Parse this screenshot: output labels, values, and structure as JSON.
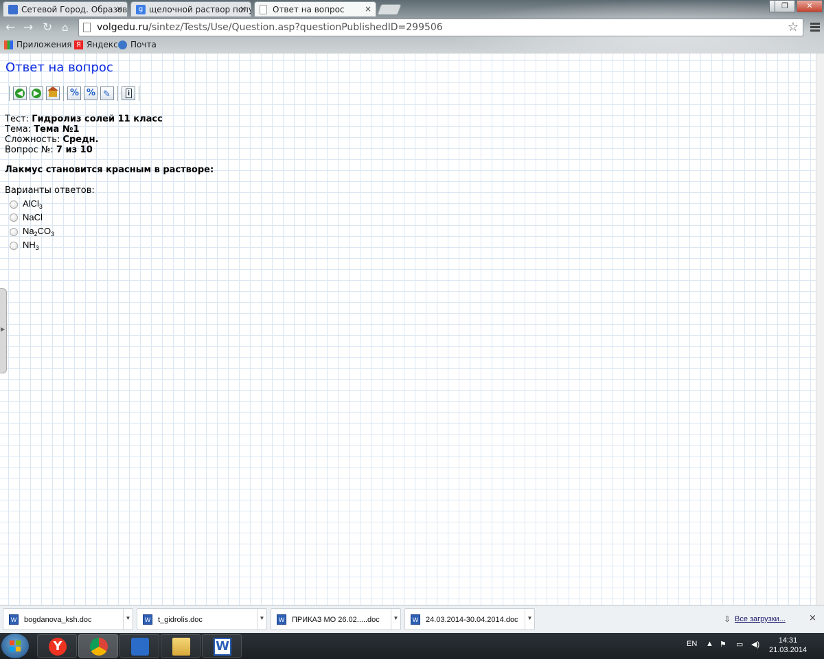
{
  "browser": {
    "tabs": [
      {
        "title": "Сетевой Город. Образов",
        "icon": "network-city-icon",
        "active": false
      },
      {
        "title": "щелочной раствор полу",
        "icon": "google-icon",
        "active": false
      },
      {
        "title": "Ответ на вопрос",
        "icon": "page-icon",
        "active": true
      }
    ],
    "tab_close": "×",
    "url_host": "volgedu.ru",
    "url_path": "/sintez/Tests/Use/Question.asp?questionPublishedID=299506",
    "bookmarks": [
      {
        "label": "Приложения",
        "icon": "apps-icon"
      },
      {
        "label": "Яндекс",
        "icon": "yandex-icon"
      },
      {
        "label": "Почта",
        "icon": "mail-icon"
      }
    ]
  },
  "page": {
    "title": "Ответ на вопрос",
    "toolbar_icons": [
      "back-icon",
      "forward-icon",
      "home-icon",
      "percent-icon",
      "percent-alt-icon",
      "pencil-icon",
      "info-icon"
    ],
    "test_label": "Тест:",
    "test_value": "Гидролиз солей 11 класс",
    "topic_label": "Тема:",
    "topic_value": "Тема №1",
    "difficulty_label": "Сложность:",
    "difficulty_value": "Средн.",
    "question_num_label": "Вопрос №:",
    "question_num_value": "7 из 10",
    "question_text": "Лакмус становится красным в растворе:",
    "variants_label": "Варианты ответов:",
    "options": [
      {
        "parts": [
          "AlCl",
          "3",
          ""
        ]
      },
      {
        "parts": [
          "NaCl",
          "",
          ""
        ]
      },
      {
        "parts": [
          "Na",
          "2",
          "CO",
          "3"
        ]
      },
      {
        "parts": [
          "NH",
          "3",
          ""
        ]
      }
    ]
  },
  "downloads": {
    "items": [
      {
        "name": "bogdanova_ksh.doc"
      },
      {
        "name": "t_gidrolis.doc"
      },
      {
        "name": "ПРИКАЗ МО 26.02.....doc"
      },
      {
        "name": "24.03.2014-30.04.2014.doc"
      }
    ],
    "all_label": "Все загрузки...",
    "close": "×"
  },
  "taskbar": {
    "apps": [
      "yandex-browser-icon",
      "chrome-icon",
      "apps-grid-icon",
      "file-explorer-icon",
      "word-icon"
    ],
    "lang": "EN",
    "time": "14:31",
    "date": "21.03.2014"
  },
  "colors": {
    "title": "#0a2ae0",
    "grid": "#dbe7f3"
  }
}
